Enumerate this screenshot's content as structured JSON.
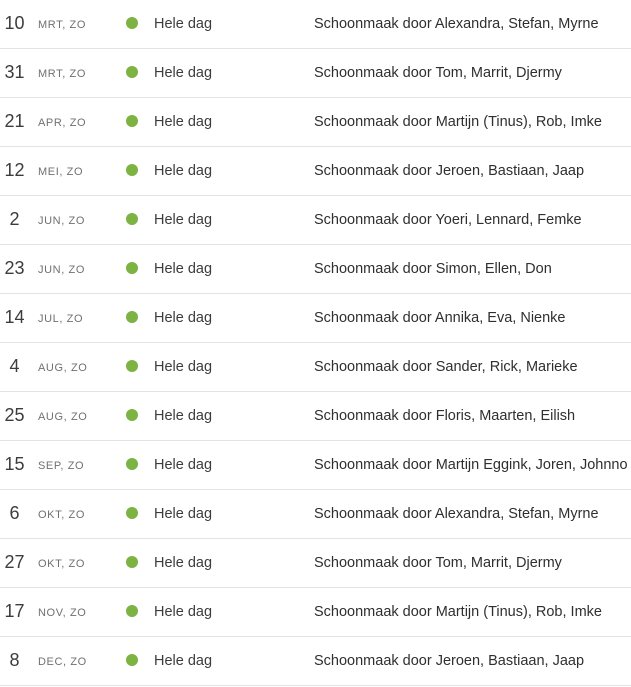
{
  "colors": {
    "event_dot": "#7cb342",
    "divider": "#e3e3e3"
  },
  "events": [
    {
      "day": "10",
      "month_weekday": "MRT, ZO",
      "time": "Hele dag",
      "title": "Schoonmaak door Alexandra, Stefan, Myrne"
    },
    {
      "day": "31",
      "month_weekday": "MRT, ZO",
      "time": "Hele dag",
      "title": "Schoonmaak door Tom, Marrit, Djermy"
    },
    {
      "day": "21",
      "month_weekday": "APR, ZO",
      "time": "Hele dag",
      "title": "Schoonmaak door Martijn (Tinus), Rob, Imke"
    },
    {
      "day": "12",
      "month_weekday": "MEI, ZO",
      "time": "Hele dag",
      "title": "Schoonmaak door Jeroen, Bastiaan, Jaap"
    },
    {
      "day": "2",
      "month_weekday": "JUN, ZO",
      "time": "Hele dag",
      "title": "Schoonmaak door Yoeri, Lennard, Femke"
    },
    {
      "day": "23",
      "month_weekday": "JUN, ZO",
      "time": "Hele dag",
      "title": "Schoonmaak door Simon, Ellen, Don"
    },
    {
      "day": "14",
      "month_weekday": "JUL, ZO",
      "time": "Hele dag",
      "title": "Schoonmaak door Annika, Eva, Nienke"
    },
    {
      "day": "4",
      "month_weekday": "AUG, ZO",
      "time": "Hele dag",
      "title": "Schoonmaak door Sander, Rick, Marieke"
    },
    {
      "day": "25",
      "month_weekday": "AUG, ZO",
      "time": "Hele dag",
      "title": "Schoonmaak door Floris, Maarten, Eilish"
    },
    {
      "day": "15",
      "month_weekday": "SEP, ZO",
      "time": "Hele dag",
      "title": "Schoonmaak door Martijn Eggink, Joren, Johnno"
    },
    {
      "day": "6",
      "month_weekday": "OKT, ZO",
      "time": "Hele dag",
      "title": "Schoonmaak door Alexandra, Stefan, Myrne"
    },
    {
      "day": "27",
      "month_weekday": "OKT, ZO",
      "time": "Hele dag",
      "title": "Schoonmaak door Tom, Marrit, Djermy"
    },
    {
      "day": "17",
      "month_weekday": "NOV, ZO",
      "time": "Hele dag",
      "title": "Schoonmaak door Martijn (Tinus), Rob, Imke"
    },
    {
      "day": "8",
      "month_weekday": "DEC, ZO",
      "time": "Hele dag",
      "title": "Schoonmaak door Jeroen, Bastiaan, Jaap"
    }
  ]
}
